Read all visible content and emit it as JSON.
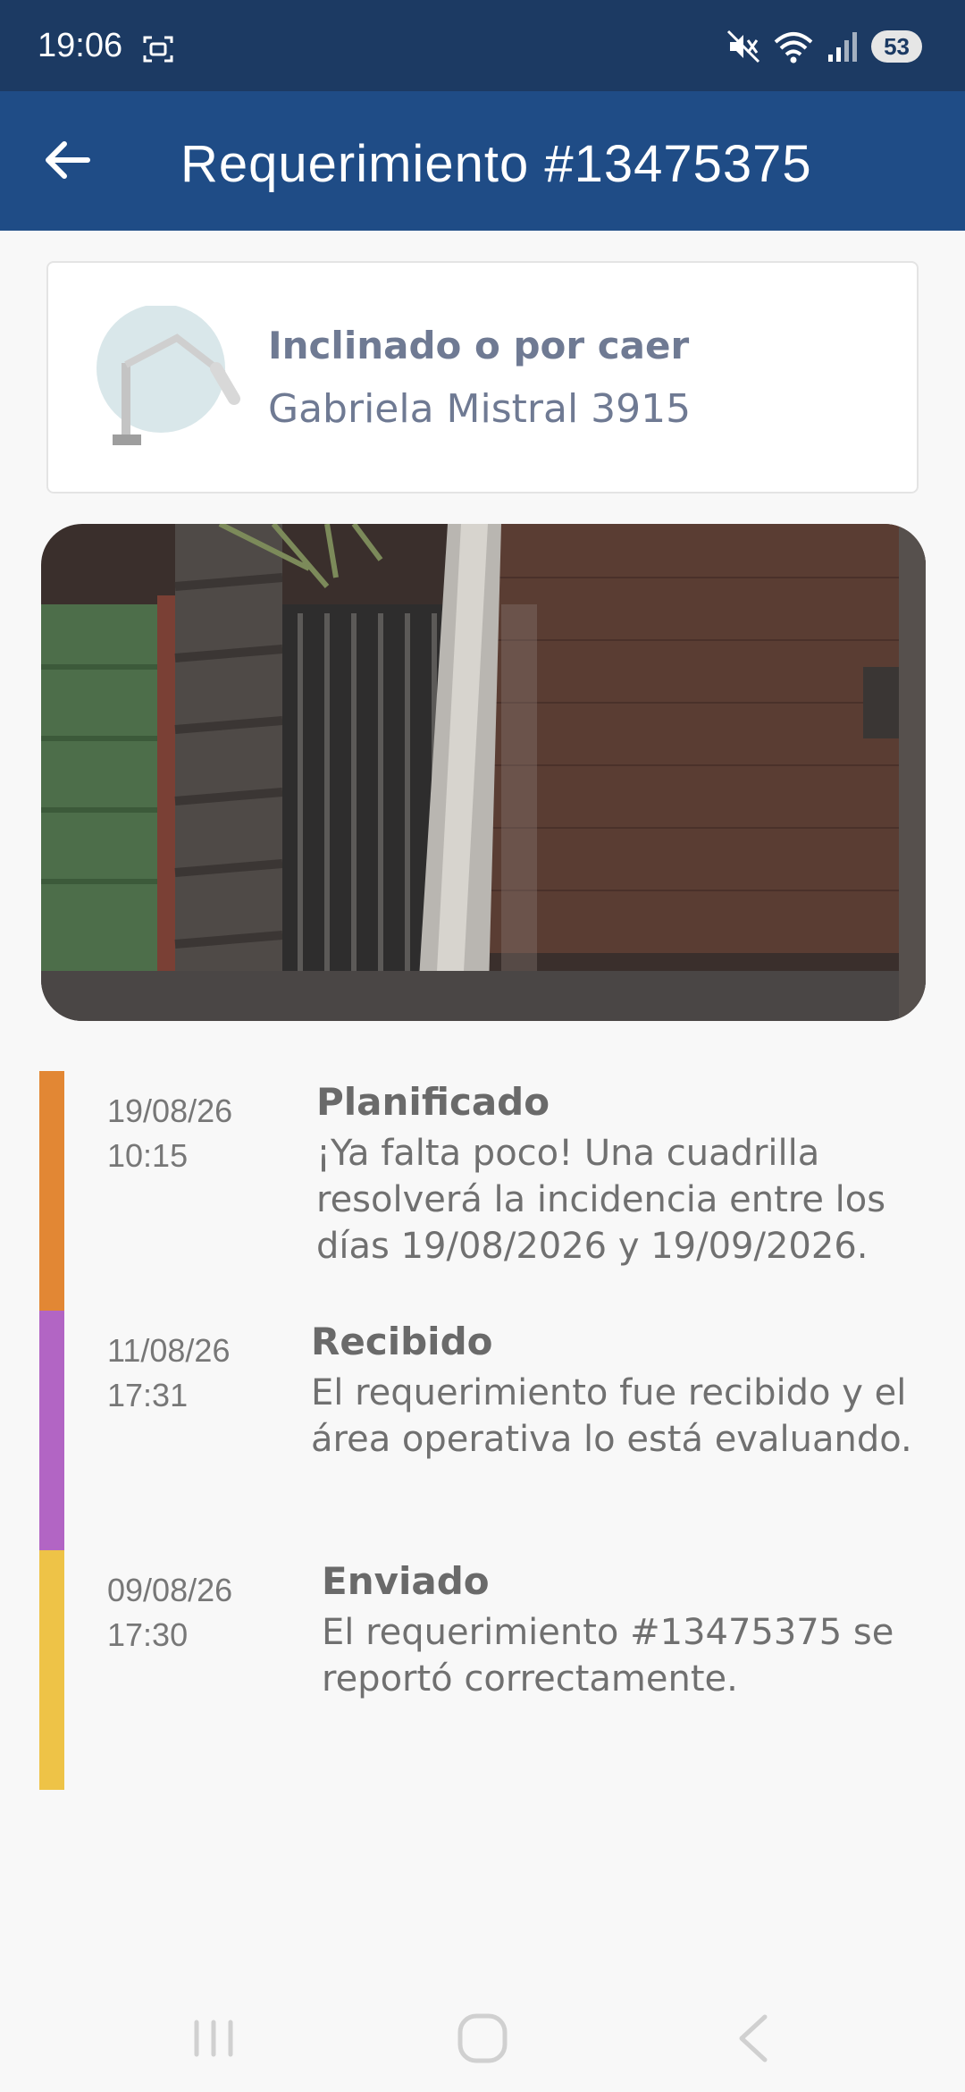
{
  "status_bar": {
    "time": "19:06",
    "battery": "53",
    "icons": [
      "screen-record-icon",
      "mute-icon",
      "wifi-icon",
      "signal-icon",
      "battery-icon"
    ]
  },
  "app_bar": {
    "title": "Requerimiento #13475375",
    "back_icon": "arrow-left-icon"
  },
  "card": {
    "icon": "streetlight-icon",
    "title": "Inclinado o por caer",
    "address": "Gabriela Mistral 3915"
  },
  "photo": {
    "alt_icon": "photo-of-leaning-pole"
  },
  "timeline": {
    "events": [
      {
        "date": "19/08/26",
        "time": "10:15",
        "title": "Planificado",
        "text": "¡Ya falta poco! Una cuadrilla resolverá la incidencia entre los días 19/08/2026 y 19/09/2026.",
        "color": "#e28734"
      },
      {
        "date": "11/08/26",
        "time": "17:31",
        "title": "Recibido",
        "text": "El requerimiento fue recibido y el área operativa lo está evaluando.",
        "color": "#b265c4"
      },
      {
        "date": "09/08/26",
        "time": "17:30",
        "title": "Enviado",
        "text": "El requerimiento #13475375 se reportó correctamente.",
        "color": "#eec347"
      }
    ]
  },
  "nav_bar": {
    "icons": [
      "recent-apps-icon",
      "home-icon",
      "back-icon"
    ]
  },
  "colors": {
    "status_bar": "#1c3a63",
    "app_bar": "#1f4c86",
    "card_text": "#6f7a93",
    "background": "#f8f8f8"
  }
}
